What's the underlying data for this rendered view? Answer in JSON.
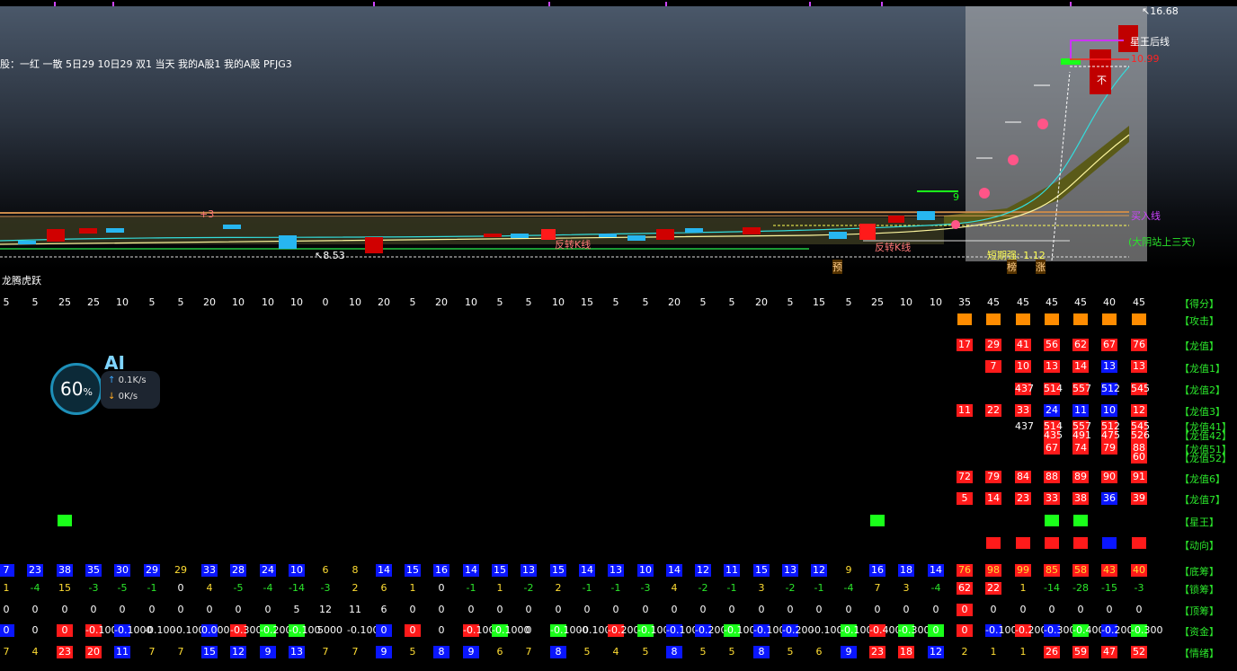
{
  "stock_text": "股：一红 一散 5日29 10日29 双1 当天 我的A股1 我的A股 PFJG3",
  "indicator_title": "龙腾虎跃",
  "price_labels": {
    "high": "16.68",
    "low": "8.53",
    "mid": "10.99"
  },
  "chart_labels": {
    "star_king_line": "星王后线",
    "buy_line": "买入线",
    "big_yin": "(大阴站上三天)",
    "short_strong": "短期强: 1.12",
    "pre": "预",
    "bang": "榜",
    "zhang": "涨",
    "nine": "9",
    "reverse_k1": "反转K线",
    "reverse_k2": "反转K线",
    "plus3": "+3",
    "no": "不"
  },
  "row_labels": {
    "score": "【得分】",
    "attack": "【攻击】",
    "longzhi": "【龙值】",
    "longzhi1": "【龙值1】",
    "longzhi2": "【龙值2】",
    "longzhi3": "【龙值3】",
    "longzhi41": "【龙值41】",
    "longzhi42": "【龙值42】",
    "longzhi51": "【龙值51】",
    "longzhi52": "【龙值52】",
    "longzhi6": "【龙值6】",
    "longzhi7": "【龙值7】",
    "xingwang": "【星王】",
    "dongxiang": "【动向】",
    "dichou": "【底筹】",
    "suochou": "【锁筹】",
    "dingchou": "【顶筹】",
    "zijin": "【资金】",
    "qingxu": "【情绪】"
  },
  "scores": [
    "5",
    "5",
    "25",
    "25",
    "10",
    "5",
    "5",
    "20",
    "10",
    "10",
    "10",
    "0",
    "10",
    "20",
    "5",
    "20",
    "10",
    "5",
    "5",
    "10",
    "15",
    "5",
    "5",
    "20",
    "5",
    "5",
    "20",
    "5",
    "15",
    "5",
    "25",
    "10",
    "10",
    "35",
    "45",
    "45",
    "45",
    "45",
    "40",
    "45"
  ],
  "dichou": [
    "7",
    "23",
    "38",
    "35",
    "30",
    "29",
    "29",
    "33",
    "28",
    "24",
    "10",
    "6",
    "8",
    "14",
    "15",
    "16",
    "14",
    "15",
    "13",
    "15",
    "14",
    "13",
    "10",
    "14",
    "12",
    "11",
    "15",
    "13",
    "12",
    "9",
    "16",
    "18",
    "14",
    "76",
    "98",
    "99",
    "85",
    "58",
    "43",
    "40"
  ],
  "suochou": [
    "1",
    "-4",
    "15",
    "-3",
    "-5",
    "-1",
    "0",
    "4",
    "-5",
    "-4",
    "-14",
    "-3",
    "2",
    "6",
    "1",
    "0",
    "-1",
    "1",
    "-2",
    "2",
    "-1",
    "-1",
    "-3",
    "4",
    "-2",
    "-1",
    "3",
    "-2",
    "-1",
    "-4",
    "7",
    "3",
    "-4",
    "62",
    "22",
    "1",
    "-14",
    "-28",
    "-15",
    "-3"
  ],
  "dingchou": [
    "0",
    "0",
    "0",
    "0",
    "0",
    "0",
    "0",
    "0",
    "0",
    "0",
    "5",
    "12",
    "11",
    "6",
    "0",
    "0",
    "0",
    "0",
    "0",
    "0",
    "0",
    "0",
    "0",
    "0",
    "0",
    "0",
    "0",
    "0",
    "0",
    "0",
    "0",
    "0",
    "0",
    "0",
    "0",
    "0",
    "0",
    "0",
    "0",
    "0"
  ],
  "qingxu": [
    "7",
    "4",
    "23",
    "20",
    "11",
    "7",
    "7",
    "15",
    "12",
    "9",
    "13",
    "7",
    "7",
    "9",
    "5",
    "8",
    "9",
    "6",
    "7",
    "8",
    "5",
    "4",
    "5",
    "8",
    "5",
    "5",
    "8",
    "5",
    "6",
    "9",
    "23",
    "18",
    "12",
    "2",
    "1",
    "1",
    "26",
    "59",
    "47",
    "52"
  ],
  "zijin": [
    "0",
    "0",
    "0",
    "-0.100",
    "-0.1000",
    "-0.100",
    "-0.100",
    "0.000",
    "-0.300",
    "-0.200",
    "-0.100",
    "5000",
    "-0.100",
    "0",
    "0",
    "0",
    "-0.100",
    "-0.1000",
    "0",
    "-0.1000",
    "-0.100",
    "-0.200",
    "-0.100",
    "-0.100",
    "-0.200",
    "-0.100",
    "-0.100",
    "-0.200",
    "-0.100",
    "-0.100",
    "-0.400",
    "-0.300",
    "0",
    "0",
    "-0.100",
    "-0.200",
    "-0.300",
    "-0.400",
    "-0.200",
    "-0.300"
  ],
  "longzhi": [
    "17",
    "29",
    "41",
    "56",
    "62",
    "67",
    "76"
  ],
  "longzhi1": [
    "7",
    "10",
    "13",
    "14",
    "13",
    "13"
  ],
  "longzhi2": [
    "437",
    "514",
    "557",
    "512",
    "545"
  ],
  "longzhi3": [
    "11",
    "22",
    "33",
    "24",
    "11",
    "10",
    "12"
  ],
  "longzhi41": [
    "437",
    "514",
    "557",
    "512",
    "545"
  ],
  "longzhi42": [
    "435",
    "491",
    "475",
    "526"
  ],
  "longzhi51": [
    "67",
    "74",
    "79",
    "88"
  ],
  "longzhi52": [
    "60"
  ],
  "longzhi6": [
    "72",
    "79",
    "84",
    "88",
    "89",
    "90",
    "91"
  ],
  "longzhi7": [
    "5",
    "14",
    "23",
    "33",
    "38",
    "36",
    "39"
  ],
  "ai": {
    "tag": "AI",
    "percent": "60",
    "unit": "%",
    "up": "0.1",
    "down": "0",
    "rate_unit": "K/s"
  },
  "colors": {
    "red": "#ff1a1a",
    "blue": "#0a16ff",
    "green": "#1aff1a",
    "orange": "#ff8c00",
    "label_green": "#2be52b"
  }
}
